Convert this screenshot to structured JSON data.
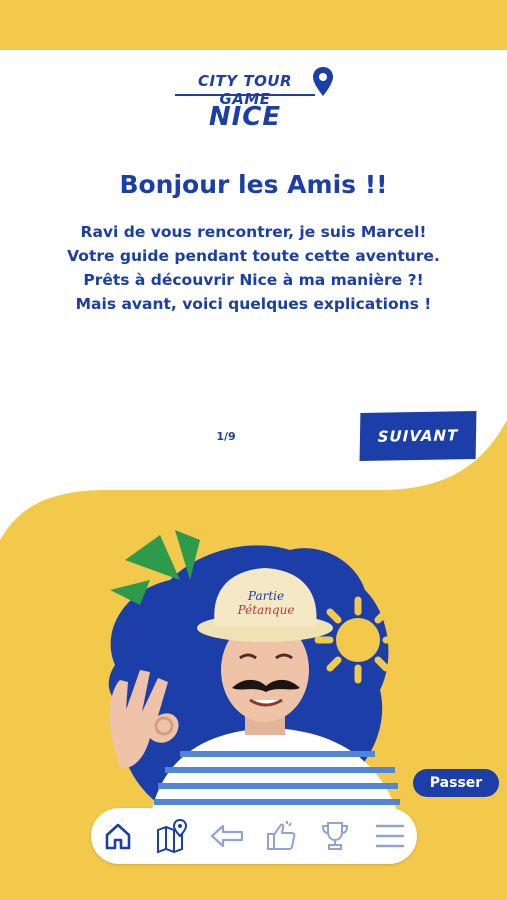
{
  "logo": {
    "line1": "CITY TOUR GAME",
    "line2": "NICE"
  },
  "greeting": "Bonjour les Amis !!",
  "intro": {
    "line1_pre": "Ravi de vous rencontrer, je suis ",
    "line1_name": "Marcel",
    "line1_post": "!",
    "line2": "Votre guide pendant toute cette aventure.",
    "line3": "Prêts à découvrir Nice à ma manière ?!",
    "line4": "Mais avant, voici quelques explications !"
  },
  "pagination": {
    "counter": "1/9"
  },
  "buttons": {
    "next": "SUIVANT",
    "skip": "Passer"
  },
  "hat_text": {
    "line1": "Partie",
    "line2": "Pétanque"
  },
  "nav": {
    "items": [
      {
        "icon": "home-icon",
        "active": true
      },
      {
        "icon": "map-pin-icon",
        "active": false
      },
      {
        "icon": "back-arrow-icon",
        "active": false
      },
      {
        "icon": "thumbs-up-icon",
        "active": false
      },
      {
        "icon": "trophy-icon",
        "active": false
      },
      {
        "icon": "menu-icon",
        "active": false
      }
    ]
  },
  "colors": {
    "brand_blue": "#1b3ea8",
    "brand_yellow": "#f3c94c",
    "green": "#2e9a4c",
    "inactive_icon": "#8fa3d8"
  }
}
